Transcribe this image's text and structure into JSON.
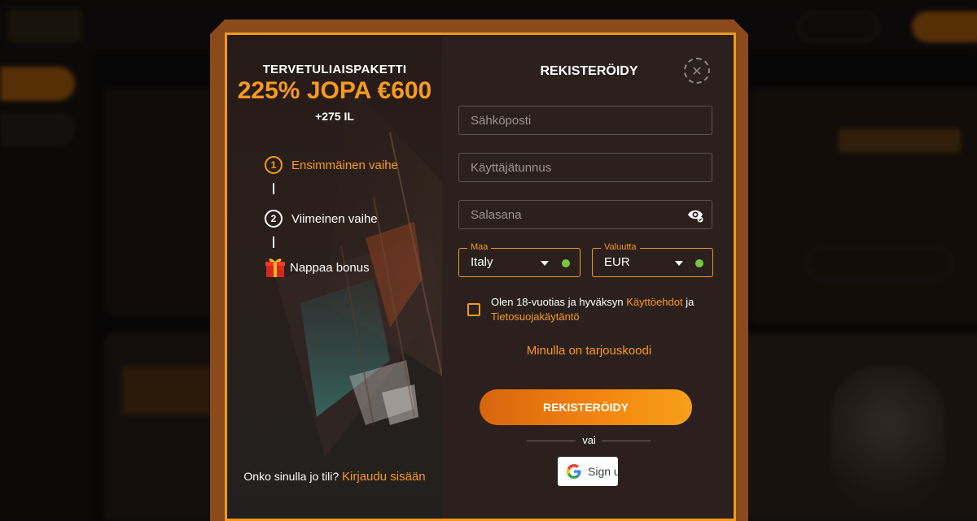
{
  "promo": {
    "title": "TERVETULIAISPAKETTI",
    "amount": "225% JOPA €600",
    "extra": "+275 IL"
  },
  "steps": [
    {
      "number": "1",
      "label": "Ensimmäinen vaihe"
    },
    {
      "number": "2",
      "label": "Viimeinen vaihe"
    }
  ],
  "bonus_label": "Nappaa bonus",
  "login": {
    "question": "Onko sinulla jo tili?",
    "link": "Kirjaudu sisään"
  },
  "form": {
    "title": "REKISTERÖIDY",
    "email_placeholder": "Sähköposti",
    "username_placeholder": "Käyttäjätunnus",
    "password_placeholder": "Salasana",
    "country": {
      "label": "Maa",
      "value": "Italy"
    },
    "currency": {
      "label": "Valuutta",
      "value": "EUR"
    },
    "terms": {
      "prefix": "Olen 18-vuotias ja hyväksyn",
      "terms_link": "Käyttöehdot",
      "joiner": "ja",
      "privacy_link": "Tietosuojakäytäntö"
    },
    "promo_code_link": "Minulla on tarjouskoodi",
    "submit_label": "REKISTERÖIDY",
    "or_text": "vai",
    "google_label": "Sign up with Google"
  },
  "colors": {
    "accent": "#f79a1e",
    "frame": "#f29a1f",
    "modal_bg": "#2b201d",
    "valid": "#7cc63b"
  },
  "icons": [
    "close-icon",
    "eye-icon",
    "chevron-down-icon",
    "check-dot-icon",
    "gift-icon",
    "google-icon"
  ]
}
